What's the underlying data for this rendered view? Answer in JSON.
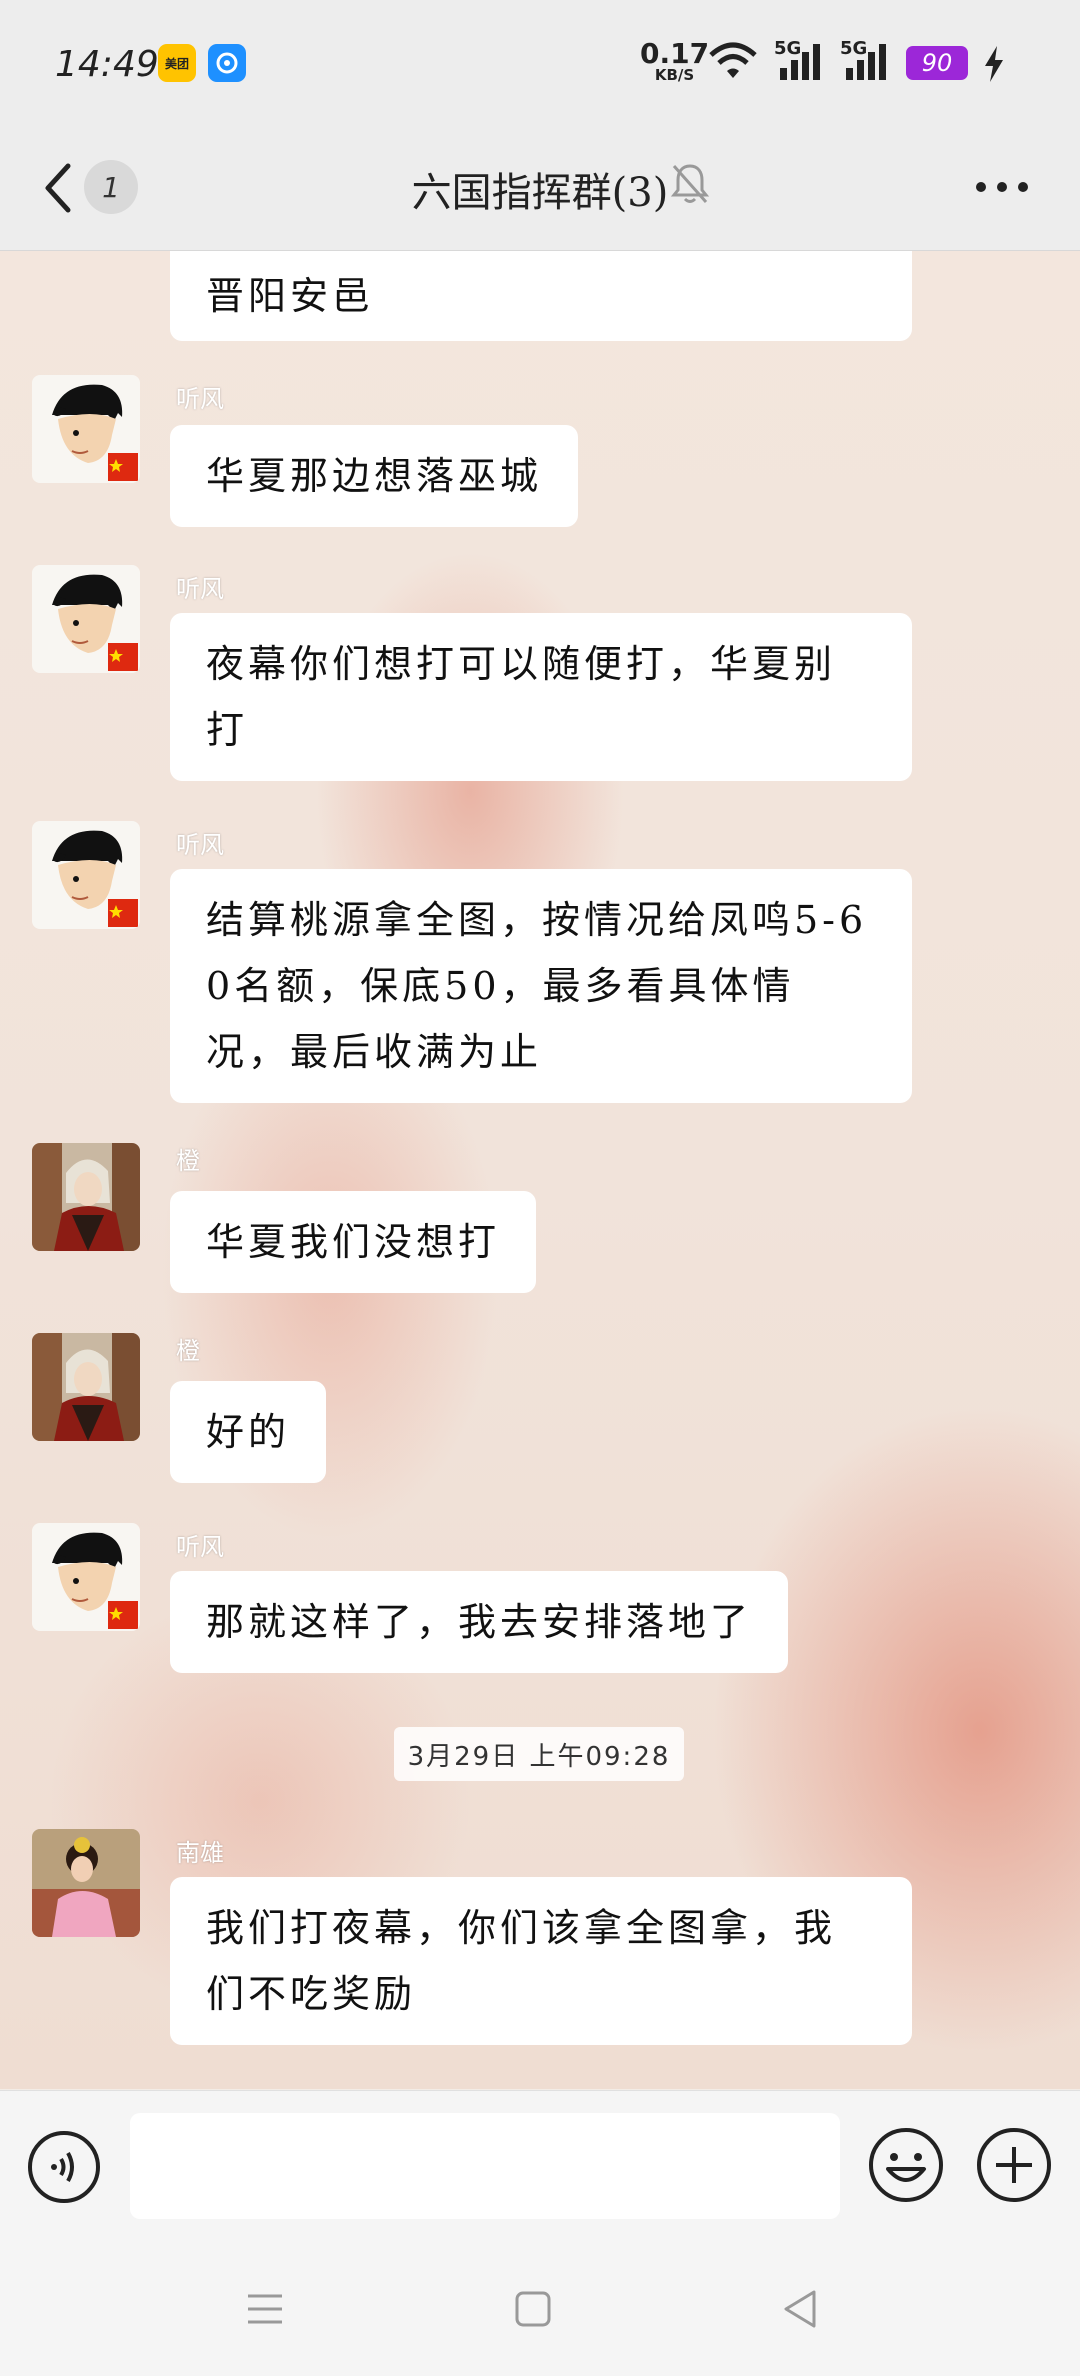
{
  "status_bar": {
    "time": "14:49",
    "app_badges": [
      "美团",
      ""
    ],
    "net_speed_value": "0.17",
    "net_speed_unit": "KB/S",
    "signal_1": "5G",
    "signal_2": "5G",
    "battery": "90"
  },
  "header": {
    "unread_count": "1",
    "title": "六国指挥群(3)"
  },
  "messages": [
    {
      "sender": "",
      "text": "晋阳安邑"
    },
    {
      "sender": "听风",
      "text": "华夏那边想落巫城"
    },
    {
      "sender": "听风",
      "text": "夜幕你们想打可以随便打，华夏别打"
    },
    {
      "sender": "听风",
      "text": "结算桃源拿全图，按情况给凤鸣5-60名额，保底50，最多看具体情况，最后收满为止"
    },
    {
      "sender": "橙",
      "text": "华夏我们没想打"
    },
    {
      "sender": "橙",
      "text": "好的"
    },
    {
      "sender": "听风",
      "text": "那就这样了，我去安排落地了"
    },
    {
      "sender": "南雄",
      "text": "我们打夜幕，你们该拿全图拿，我们不吃奖励"
    }
  ],
  "timestamp": "3月29日 上午09:28",
  "input": {
    "placeholder": ""
  },
  "colors": {
    "bubble": "#ffffff",
    "battery": "#9c27d8",
    "wallpaper_accent": "#e28c78"
  },
  "icons": [
    "back-icon",
    "bell-off-icon",
    "more-icon",
    "voice-icon",
    "emoji-icon",
    "plus-icon",
    "menu-icon",
    "home-icon",
    "back-triangle-icon"
  ]
}
